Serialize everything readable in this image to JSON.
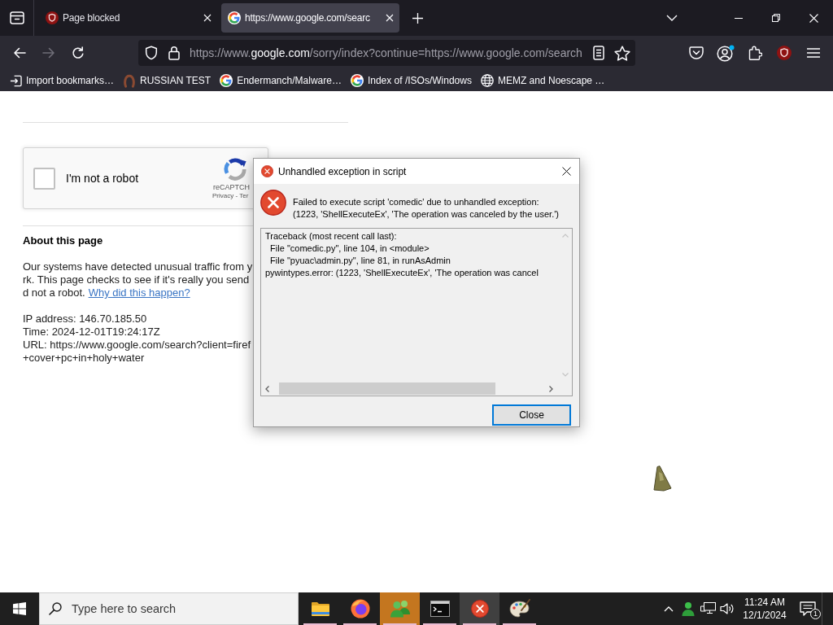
{
  "browser": {
    "tabs": [
      {
        "kind": "ublock",
        "title": "Page blocked",
        "selected": false
      },
      {
        "kind": "google",
        "title": "https://www.google.com/searc",
        "selected": true
      }
    ],
    "nav_buttons": [
      {
        "kind": "back",
        "disabled": false
      },
      {
        "kind": "forward",
        "disabled": true
      },
      {
        "kind": "reload",
        "disabled": false
      }
    ],
    "address_bar": {
      "url": {
        "prefix": "https://www.",
        "domain": "google.com",
        "path": "/sorry/index?continue=https://www.google.com/search"
      }
    },
    "bookmarks": [
      {
        "kind": "import",
        "label": "Import bookmarks…"
      },
      {
        "kind": "horseshoe",
        "label": "RUSSIAN TEST"
      },
      {
        "kind": "google",
        "label": "Endermanch/Malware…"
      },
      {
        "kind": "google",
        "label": "Index of /ISOs/Windows"
      },
      {
        "kind": "globe",
        "label": "MEMZ and Noescape …"
      }
    ]
  },
  "page": {
    "captcha": {
      "label": "I'm not a robot",
      "checked": false,
      "brand": "reCAPTCH",
      "links": "Privacy - Ter"
    },
    "heading": "About this page",
    "paragraph_lines": [
      {
        "text": "Our systems have detected unusual traffic from y"
      },
      {
        "text": "rk. This page checks to see if it's really you send"
      },
      {
        "text": "d not a robot.",
        "link": "Why did this happen?"
      }
    ],
    "details_lines": [
      "IP address: 146.70.185.50",
      "Time: 2024-12-01T19:24:17Z",
      "URL: https://www.google.com/search?client=firef",
      "+cover+pc+in+holy+water"
    ]
  },
  "dialog": {
    "title": "Unhandled exception in script",
    "message_lines": [
      "Failed to execute script 'comedic' due to unhandled exception:",
      "(1223, 'ShellExecuteEx', 'The operation was canceled by the user.')"
    ],
    "traceback_lines": [
      "Traceback (most recent call last):",
      "  File \"comedic.py\", line 104, in <module>",
      "  File \"pyuac\\admin.py\", line 81, in runAsAdmin",
      "pywintypes.error: (1223, 'ShellExecuteEx', 'The operation was cancel"
    ],
    "button": {
      "label": "Close",
      "default": true
    }
  },
  "taskbar": {
    "search": {
      "placeholder": "Type here to search"
    },
    "apps": [
      {
        "kind": "folder",
        "active": false,
        "attention": false
      },
      {
        "kind": "firefox",
        "active": false,
        "attention": false
      },
      {
        "kind": "people",
        "active": false,
        "attention": true
      },
      {
        "kind": "terminal",
        "active": false,
        "attention": false
      },
      {
        "kind": "error",
        "active": true,
        "attention": false
      },
      {
        "kind": "paint",
        "active": false,
        "attention": false
      }
    ],
    "clock": {
      "time": "11:24 AM",
      "date": "12/1/2024"
    },
    "notifications": {
      "count": "1"
    }
  }
}
